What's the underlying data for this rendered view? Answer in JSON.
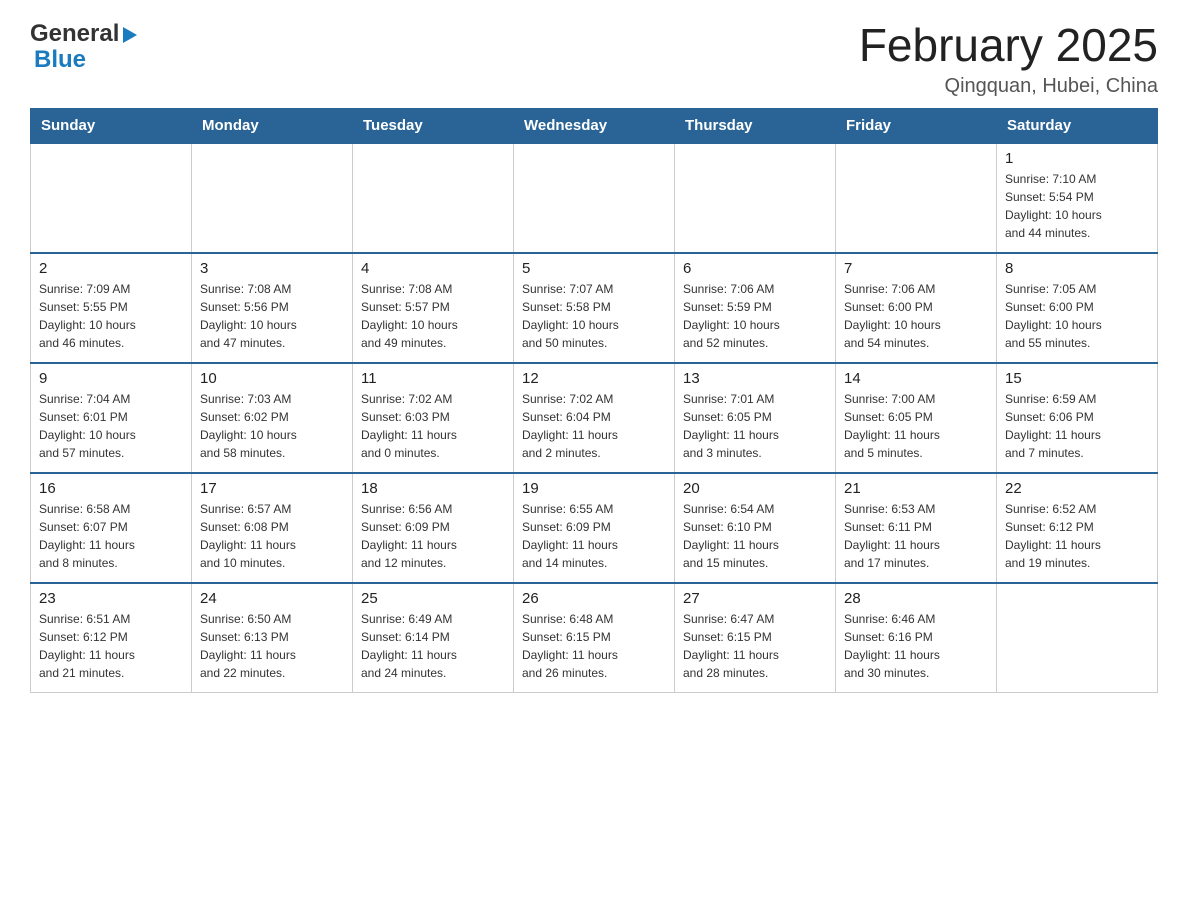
{
  "header": {
    "logo_general": "General",
    "logo_blue": "Blue",
    "month_title": "February 2025",
    "location": "Qingquan, Hubei, China"
  },
  "calendar": {
    "days_of_week": [
      "Sunday",
      "Monday",
      "Tuesday",
      "Wednesday",
      "Thursday",
      "Friday",
      "Saturday"
    ],
    "weeks": [
      [
        {
          "day": "",
          "info": ""
        },
        {
          "day": "",
          "info": ""
        },
        {
          "day": "",
          "info": ""
        },
        {
          "day": "",
          "info": ""
        },
        {
          "day": "",
          "info": ""
        },
        {
          "day": "",
          "info": ""
        },
        {
          "day": "1",
          "info": "Sunrise: 7:10 AM\nSunset: 5:54 PM\nDaylight: 10 hours\nand 44 minutes."
        }
      ],
      [
        {
          "day": "2",
          "info": "Sunrise: 7:09 AM\nSunset: 5:55 PM\nDaylight: 10 hours\nand 46 minutes."
        },
        {
          "day": "3",
          "info": "Sunrise: 7:08 AM\nSunset: 5:56 PM\nDaylight: 10 hours\nand 47 minutes."
        },
        {
          "day": "4",
          "info": "Sunrise: 7:08 AM\nSunset: 5:57 PM\nDaylight: 10 hours\nand 49 minutes."
        },
        {
          "day": "5",
          "info": "Sunrise: 7:07 AM\nSunset: 5:58 PM\nDaylight: 10 hours\nand 50 minutes."
        },
        {
          "day": "6",
          "info": "Sunrise: 7:06 AM\nSunset: 5:59 PM\nDaylight: 10 hours\nand 52 minutes."
        },
        {
          "day": "7",
          "info": "Sunrise: 7:06 AM\nSunset: 6:00 PM\nDaylight: 10 hours\nand 54 minutes."
        },
        {
          "day": "8",
          "info": "Sunrise: 7:05 AM\nSunset: 6:00 PM\nDaylight: 10 hours\nand 55 minutes."
        }
      ],
      [
        {
          "day": "9",
          "info": "Sunrise: 7:04 AM\nSunset: 6:01 PM\nDaylight: 10 hours\nand 57 minutes."
        },
        {
          "day": "10",
          "info": "Sunrise: 7:03 AM\nSunset: 6:02 PM\nDaylight: 10 hours\nand 58 minutes."
        },
        {
          "day": "11",
          "info": "Sunrise: 7:02 AM\nSunset: 6:03 PM\nDaylight: 11 hours\nand 0 minutes."
        },
        {
          "day": "12",
          "info": "Sunrise: 7:02 AM\nSunset: 6:04 PM\nDaylight: 11 hours\nand 2 minutes."
        },
        {
          "day": "13",
          "info": "Sunrise: 7:01 AM\nSunset: 6:05 PM\nDaylight: 11 hours\nand 3 minutes."
        },
        {
          "day": "14",
          "info": "Sunrise: 7:00 AM\nSunset: 6:05 PM\nDaylight: 11 hours\nand 5 minutes."
        },
        {
          "day": "15",
          "info": "Sunrise: 6:59 AM\nSunset: 6:06 PM\nDaylight: 11 hours\nand 7 minutes."
        }
      ],
      [
        {
          "day": "16",
          "info": "Sunrise: 6:58 AM\nSunset: 6:07 PM\nDaylight: 11 hours\nand 8 minutes."
        },
        {
          "day": "17",
          "info": "Sunrise: 6:57 AM\nSunset: 6:08 PM\nDaylight: 11 hours\nand 10 minutes."
        },
        {
          "day": "18",
          "info": "Sunrise: 6:56 AM\nSunset: 6:09 PM\nDaylight: 11 hours\nand 12 minutes."
        },
        {
          "day": "19",
          "info": "Sunrise: 6:55 AM\nSunset: 6:09 PM\nDaylight: 11 hours\nand 14 minutes."
        },
        {
          "day": "20",
          "info": "Sunrise: 6:54 AM\nSunset: 6:10 PM\nDaylight: 11 hours\nand 15 minutes."
        },
        {
          "day": "21",
          "info": "Sunrise: 6:53 AM\nSunset: 6:11 PM\nDaylight: 11 hours\nand 17 minutes."
        },
        {
          "day": "22",
          "info": "Sunrise: 6:52 AM\nSunset: 6:12 PM\nDaylight: 11 hours\nand 19 minutes."
        }
      ],
      [
        {
          "day": "23",
          "info": "Sunrise: 6:51 AM\nSunset: 6:12 PM\nDaylight: 11 hours\nand 21 minutes."
        },
        {
          "day": "24",
          "info": "Sunrise: 6:50 AM\nSunset: 6:13 PM\nDaylight: 11 hours\nand 22 minutes."
        },
        {
          "day": "25",
          "info": "Sunrise: 6:49 AM\nSunset: 6:14 PM\nDaylight: 11 hours\nand 24 minutes."
        },
        {
          "day": "26",
          "info": "Sunrise: 6:48 AM\nSunset: 6:15 PM\nDaylight: 11 hours\nand 26 minutes."
        },
        {
          "day": "27",
          "info": "Sunrise: 6:47 AM\nSunset: 6:15 PM\nDaylight: 11 hours\nand 28 minutes."
        },
        {
          "day": "28",
          "info": "Sunrise: 6:46 AM\nSunset: 6:16 PM\nDaylight: 11 hours\nand 30 minutes."
        },
        {
          "day": "",
          "info": ""
        }
      ]
    ]
  }
}
